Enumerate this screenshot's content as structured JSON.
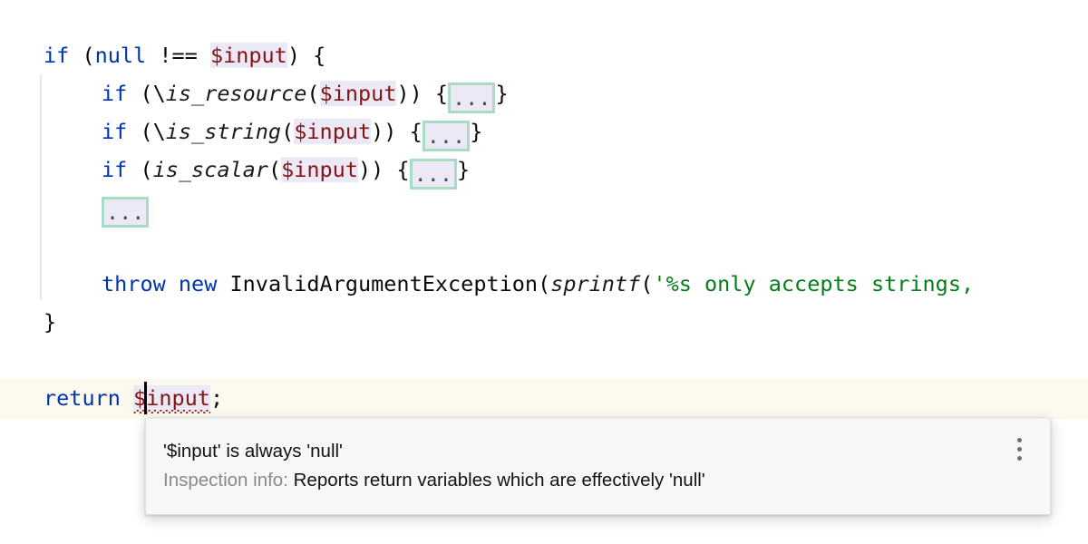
{
  "editor": {
    "language": "php",
    "background": "#ffffff",
    "caret_line_color": "#fcfaef",
    "variable_highlight_color": "#ece9f7",
    "fold_border_color": "#a9dbc5",
    "keyword_color": "#0033b3",
    "variable_color": "#871414",
    "string_color": "#067d17",
    "lines": [
      {
        "id": "line-if-null",
        "indent": 0,
        "text": "if (null !== $input) {",
        "tokens": [
          {
            "kind": "keyword",
            "text": "if"
          },
          {
            "kind": "plain",
            "text": " ("
          },
          {
            "kind": "keyword",
            "text": "null"
          },
          {
            "kind": "plain",
            "text": " !== "
          },
          {
            "kind": "variable",
            "text": "$input"
          },
          {
            "kind": "plain",
            "text": ") {"
          }
        ]
      },
      {
        "id": "line-if-is-resource",
        "indent": 1,
        "text": "if (\\is_resource($input)) {...}",
        "tokens": [
          {
            "kind": "keyword",
            "text": "if"
          },
          {
            "kind": "plain",
            "text": " (\\"
          },
          {
            "kind": "function",
            "text": "is_resource"
          },
          {
            "kind": "plain",
            "text": "("
          },
          {
            "kind": "variable",
            "text": "$input"
          },
          {
            "kind": "plain",
            "text": ")) {"
          },
          {
            "kind": "fold",
            "text": "..."
          },
          {
            "kind": "plain",
            "text": "}"
          }
        ]
      },
      {
        "id": "line-if-is-string",
        "indent": 1,
        "text": "if (\\is_string($input)) {...}",
        "tokens": [
          {
            "kind": "keyword",
            "text": "if"
          },
          {
            "kind": "plain",
            "text": " (\\"
          },
          {
            "kind": "function",
            "text": "is_string"
          },
          {
            "kind": "plain",
            "text": "("
          },
          {
            "kind": "variable",
            "text": "$input"
          },
          {
            "kind": "plain",
            "text": ")) {"
          },
          {
            "kind": "fold",
            "text": "..."
          },
          {
            "kind": "plain",
            "text": "}"
          }
        ]
      },
      {
        "id": "line-if-is-scalar",
        "indent": 1,
        "text": "if (is_scalar($input)) {...}",
        "tokens": [
          {
            "kind": "keyword",
            "text": "if"
          },
          {
            "kind": "plain",
            "text": " ("
          },
          {
            "kind": "function",
            "text": "is_scalar"
          },
          {
            "kind": "plain",
            "text": "("
          },
          {
            "kind": "variable",
            "text": "$input"
          },
          {
            "kind": "plain",
            "text": ")) {"
          },
          {
            "kind": "fold",
            "text": "..."
          },
          {
            "kind": "plain",
            "text": "}"
          }
        ]
      },
      {
        "id": "line-folded-block",
        "indent": 1,
        "text": "...",
        "tokens": [
          {
            "kind": "fold",
            "text": "..."
          }
        ]
      },
      {
        "id": "line-blank",
        "indent": 0,
        "text": "",
        "tokens": []
      },
      {
        "id": "line-throw",
        "indent": 1,
        "text": "throw new InvalidArgumentException(sprintf('%s only accepts strings,",
        "tokens": [
          {
            "kind": "keyword",
            "text": "throw"
          },
          {
            "kind": "plain",
            "text": " "
          },
          {
            "kind": "keyword",
            "text": "new"
          },
          {
            "kind": "plain",
            "text": " InvalidArgumentException("
          },
          {
            "kind": "function",
            "text": "sprintf"
          },
          {
            "kind": "plain",
            "text": "("
          },
          {
            "kind": "string",
            "text": "'%s only accepts strings,"
          }
        ]
      },
      {
        "id": "line-close-brace",
        "indent": 0,
        "text": "}",
        "tokens": [
          {
            "kind": "plain",
            "text": "}"
          }
        ]
      },
      {
        "id": "line-return",
        "indent": 0,
        "text": "return $input;",
        "tokens": [
          {
            "kind": "keyword",
            "text": "return"
          },
          {
            "kind": "plain",
            "text": " "
          },
          {
            "kind": "variable-error",
            "text": "$input"
          },
          {
            "kind": "plain",
            "text": ";"
          }
        ]
      }
    ]
  },
  "tooltip": {
    "message": "'$input' is always 'null'",
    "inspection_label": "Inspection info:",
    "inspection_description": "Reports return variables which are effectively 'null'",
    "menu_icon": "more-vertical-icon",
    "background": "#f7f7f7"
  }
}
